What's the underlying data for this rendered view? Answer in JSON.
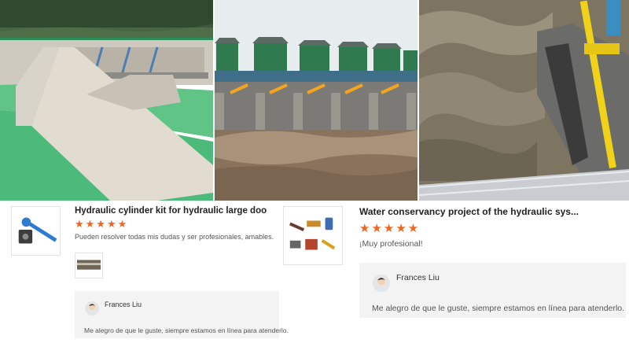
{
  "photos": [
    {
      "name": "dam-spillway-green-water-photo"
    },
    {
      "name": "floodgate-hydraulic-hoists-photo"
    },
    {
      "name": "hydraulic-cylinder-turbulent-water-photo"
    }
  ],
  "reviews": [
    {
      "title": "Hydraulic cylinder kit for hydraulic large doors ...",
      "stars": "★★★★★",
      "comment": "Pueden resolver todas mis dudas y ser profesionales, amables.",
      "reply": {
        "name": "Frances Liu",
        "text": "Me alegro de que le guste, siempre estamos en línea para atenderlo."
      }
    },
    {
      "title": "Water conservancy project of the hydraulic sys...",
      "stars": "★★★★★",
      "comment": "¡Muy profesional!",
      "reply": {
        "name": "Frances Liu",
        "text": "Me alegro de que le guste, siempre estamos en línea para atenderlo."
      }
    }
  ],
  "colors": {
    "star": "#f26522",
    "reply_bg": "#f3f3f3",
    "water_green": "#5fc486"
  }
}
